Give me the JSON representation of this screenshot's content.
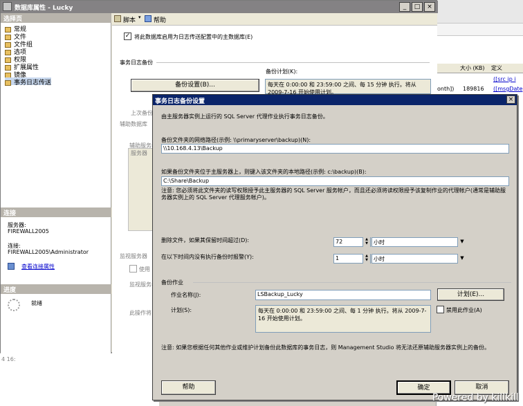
{
  "background_window": {
    "grid_headers": [
      "大小 (KB)",
      "定义"
    ],
    "rows": [
      {
        "prefix": "",
        "size": "",
        "definition": "([src ip i"
      },
      {
        "prefix": "onth])",
        "size": "189816",
        "definition": "([msgDate"
      }
    ],
    "status_text": "4 16:"
  },
  "props_window": {
    "title": "数据库属性 - Lucky",
    "controls": {
      "minimize": "_",
      "maximize": "□",
      "close": "×"
    },
    "select_page_header": "选择页",
    "nav_items": [
      "常规",
      "文件",
      "文件组",
      "选项",
      "权限",
      "扩展属性",
      "镜像",
      "事务日志传送"
    ],
    "connection_header": "连接",
    "server_label": "服务器:",
    "server_value": "FIREWALL2005",
    "conn_label": "连接:",
    "conn_value": "FIREWALL2005\\Administrator",
    "view_conn_link": "查看连接属性",
    "progress_header": "进度",
    "progress_status": "就绪",
    "toolbar": {
      "script": "脚本",
      "help": "帮助"
    },
    "enable_checkbox_label": "将此数据库启用为日志传送配置中的主数据库(E)",
    "tlog_backup_label": "事务日志备份",
    "backup_schedule_label": "备份计划(K):",
    "backup_settings_button": "备份设置(B)...",
    "backup_schedule_text": "每天在 0:00:00 和 23:59:00 之间、每 15 分钟 执行。将从 2009-7-16 开始使用计划。",
    "last_backup_label": "上次备份",
    "secondary_label": "辅助数据库",
    "secondary_server_label": "辅助服务器",
    "secondary_server_col": "服务器",
    "monitor_label": "监视服务器",
    "use_label": "使用",
    "monitor_server_label": "监视服务器",
    "this_op_label": "此操作将"
  },
  "dialog": {
    "title": "事务日志备份设置",
    "close": "×",
    "intro": "由主服务器实例上运行的 SQL Server 代理作业执行事务日志备份。",
    "network_path_label": "备份文件夹的网络路径(示例: \\\\primaryserver\\backup)(N):",
    "network_path_value": "\\\\10.168.4.13\\Backup",
    "local_path_label": "如果备份文件夹位于主服务器上，则键入该文件夹的本地路径(示例: c:\\backup)(B):",
    "local_path_value": "C:\\Share\\Backup",
    "note1": "注意: 您必须将此文件夹的读写权限授予此主服务器的 SQL Server 服务帐户，而且还必须将读权限授予该复制作业的代理帐户(通常是辅助服务器实例上的 SQL Server 代理服务帐户)。",
    "delete_label": "删除文件，如果其保留时间超过(D):",
    "delete_value": "72",
    "delete_unit": "小时",
    "alert_label": "在以下时间内没有执行备份时报警(Y):",
    "alert_value": "1",
    "alert_unit": "小时",
    "backup_job_header": "备份作业",
    "job_name_label": "作业名称(J):",
    "job_name_value": "LSBackup_Lucky",
    "schedule_button": "计划(E)...",
    "schedule_label": "计划(S):",
    "schedule_text": "每天在 0:00:00 和 23:59:00 之间、每 1 分钟 执行。将从 2009-7-16 开始使用计划。",
    "disable_job_label": "禁用此作业(A)",
    "note2": "注意: 如果您根据任何其他作业或维护计划备份此数据库的事务日志，则 Management Studio 将无法还原辅助服务器实例上的备份。",
    "help_button": "帮助",
    "ok_button": "确定",
    "cancel_button": "取消"
  },
  "watermark": "Powered by killkill"
}
